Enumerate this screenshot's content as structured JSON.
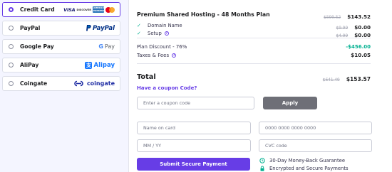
{
  "payment_methods": [
    {
      "label": "Credit Card",
      "selected": true,
      "logo": "card-brands-icon",
      "brands": [
        "VISA",
        "DISCOVER",
        "AMERICAN EXPRESS"
      ]
    },
    {
      "label": "PayPal",
      "selected": false,
      "logo": "paypal-logo",
      "logo_text": "PayPal"
    },
    {
      "label": "Google Pay",
      "selected": false,
      "logo": "google-pay-logo",
      "logo_text": "Pay"
    },
    {
      "label": "AliPay",
      "selected": false,
      "logo": "alipay-logo",
      "logo_text": "Alipay"
    },
    {
      "label": "Coingate",
      "selected": false,
      "logo": "coingate-logo",
      "logo_text": "coingate"
    }
  ],
  "summary": {
    "plan_title": "Premium Shared Hosting - 48 Months Plan",
    "plan_old_price": "$599.52",
    "plan_price": "$143.52",
    "items": [
      {
        "label": "Domain Name",
        "old_price": "$9.99",
        "price": "$0.00",
        "info": false
      },
      {
        "label": "Setup",
        "old_price": "$4.99",
        "price": "$0.00",
        "info": true
      }
    ],
    "discount_label": "Plan Discount - 76%",
    "discount_value": "-$456.00",
    "taxes_label": "Taxes & Fees",
    "taxes_value": "$10.05",
    "total_label": "Total",
    "total_old_price": "$641.49",
    "total_price": "$153.57"
  },
  "coupon": {
    "link_text": "Have a coupon Code?",
    "placeholder": "Enter a coupon code",
    "apply_label": "Apply"
  },
  "card_form": {
    "name_placeholder": "Name on card",
    "number_placeholder": "0000 0000 0000 0000",
    "expiry_placeholder": "MM / YY",
    "cvc_placeholder": "CVC code",
    "submit_label": "Submit Secure Payment"
  },
  "guarantees": [
    {
      "icon": "clock-refund-icon",
      "text": "30-Day Money-Back Guarantee"
    },
    {
      "icon": "lock-icon",
      "text": "Encrypted and Secure Payments"
    }
  ],
  "colors": {
    "accent": "#673de6",
    "success": "#00b090",
    "apply_button": "#6e6f77"
  }
}
